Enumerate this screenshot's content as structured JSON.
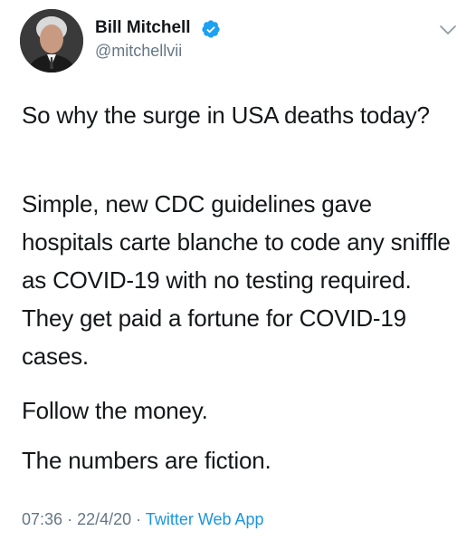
{
  "author": {
    "name": "Bill Mitchell",
    "handle": "@mitchellvii",
    "verified": true,
    "avatar_icon": "profile-photo"
  },
  "tweet": {
    "paragraphs": [
      "So why the surge in USA deaths today?",
      "Simple, new CDC guidelines gave hospitals carte blanche to code any sniffle as COVID-19 with no testing required. They get paid a fortune for COVID-19 cases.",
      "Follow the money.",
      "The numbers are fiction."
    ],
    "time": "07:36",
    "separator": "·",
    "date": "22/4/20",
    "source": "Twitter Web App"
  },
  "colors": {
    "text": "#14171a",
    "secondary": "#657786",
    "accent": "#1b95e0",
    "verified_badge": "#1da1f2"
  },
  "icons": {
    "verified": "verified-badge-icon",
    "menu": "chevron-down-icon"
  }
}
